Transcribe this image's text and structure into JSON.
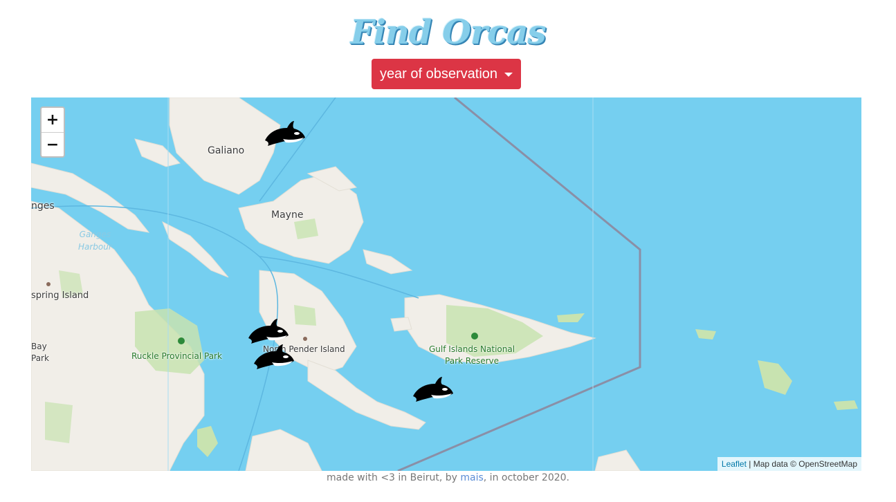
{
  "header": {
    "title": "Find Orcas"
  },
  "filter": {
    "dropdown_label": "year of observation",
    "caret": "caret-down-icon"
  },
  "map": {
    "zoom_in": "+",
    "zoom_out": "−",
    "labels": {
      "galiano": "Galiano",
      "mayne": "Mayne",
      "ganges": "nges",
      "ganges_harbour_1": "Ganges",
      "ganges_harbour_2": "Harbour",
      "saltspring": "spring Island",
      "bay_1": "Bay",
      "bay_2": "Park",
      "ruckle": "Ruckle Provincial Park",
      "north_pender": "North Pender Island",
      "gulf_islands_1": "Gulf Islands National",
      "gulf_islands_2": "Park Reserve"
    },
    "markers": [
      {
        "name": "orca-marker",
        "icon": "orca-icon"
      },
      {
        "name": "orca-marker",
        "icon": "orca-icon"
      },
      {
        "name": "orca-marker",
        "icon": "orca-icon"
      },
      {
        "name": "orca-marker",
        "icon": "orca-icon"
      }
    ],
    "attribution": {
      "leaflet": "Leaflet",
      "separator": " | ",
      "map_data": "Map data © OpenStreetMap"
    },
    "colors": {
      "water": "#75cff0",
      "land": "#f1eee8",
      "park": "#c8e3b0",
      "border": "#8a8fa6"
    }
  },
  "footer": {
    "prefix": "made with <3 in Beirut, by ",
    "author": "mais",
    "suffix": ", in october 2020."
  }
}
